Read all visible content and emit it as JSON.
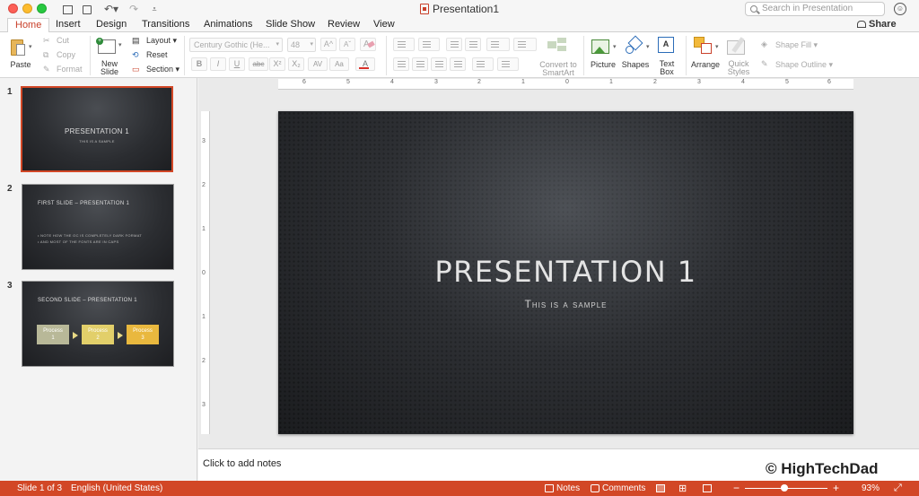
{
  "window": {
    "title": "Presentation1",
    "search_placeholder": "Search in Presentation",
    "share_label": "Share"
  },
  "tabs": [
    {
      "label": "Home",
      "active": true
    },
    {
      "label": "Insert"
    },
    {
      "label": "Design"
    },
    {
      "label": "Transitions"
    },
    {
      "label": "Animations"
    },
    {
      "label": "Slide Show"
    },
    {
      "label": "Review"
    },
    {
      "label": "View"
    }
  ],
  "ribbon": {
    "paste": "Paste",
    "cut": "Cut",
    "copy": "Copy",
    "format": "Format",
    "new_slide": "New Slide",
    "new_slide_l1": "New",
    "new_slide_l2": "Slide",
    "layout": "Layout",
    "reset": "Reset",
    "section": "Section",
    "font_name": "Century Gothic (He...",
    "font_size": "48",
    "convert_smartart_l1": "Convert to",
    "convert_smartart_l2": "SmartArt",
    "picture": "Picture",
    "shapes": "Shapes",
    "text_box_l1": "Text",
    "text_box_l2": "Box",
    "arrange": "Arrange",
    "quick_styles_l1": "Quick",
    "quick_styles_l2": "Styles",
    "shape_fill": "Shape Fill",
    "shape_outline": "Shape Outline",
    "bold": "B",
    "italic": "I",
    "underline": "U",
    "strike": "abc",
    "superscript": "X²",
    "subscript": "X₂",
    "char_spacing": "AV",
    "change_case": "Aa",
    "font_color": "A",
    "grow": "A",
    "shrink": "A"
  },
  "thumbnails": [
    {
      "num": "1",
      "title": "PRESENTATION 1",
      "subtitle": "THIS IS A SAMPLE"
    },
    {
      "num": "2",
      "title": "FIRST SLIDE – PRESENTATION 1",
      "bullets": [
        "NOTE HOW THE OC IS COMPLETELY DARK FORMAT",
        "AND MOST OF THE FONTS ARE IN CAPS"
      ]
    },
    {
      "num": "3",
      "title": "SECOND SLIDE – PRESENTATION 1",
      "process": [
        {
          "l1": "Process",
          "l2": "1",
          "color": "#b8b898"
        },
        {
          "l1": "Process",
          "l2": "2",
          "color": "#e2cf6a"
        },
        {
          "l1": "Process",
          "l2": "3",
          "color": "#e9b83e"
        }
      ]
    }
  ],
  "ruler_h": [
    "6",
    "5",
    "4",
    "3",
    "2",
    "1",
    "0",
    "1",
    "2",
    "3",
    "4",
    "5",
    "6"
  ],
  "ruler_v": [
    "3",
    "2",
    "1",
    "0",
    "1",
    "2",
    "3"
  ],
  "slide": {
    "title": "PRESENTATION 1",
    "subtitle": "This is a sample"
  },
  "notes_placeholder": "Click to add notes",
  "watermark": "© HighTechDad",
  "status": {
    "slide_info": "Slide 1 of 3",
    "language": "English (United States)",
    "notes": "Notes",
    "comments": "Comments",
    "zoom_minus": "−",
    "zoom_plus": "+",
    "zoom": "93%"
  },
  "colors": {
    "accent": "#d24726",
    "tab_active": "#c9402a"
  }
}
